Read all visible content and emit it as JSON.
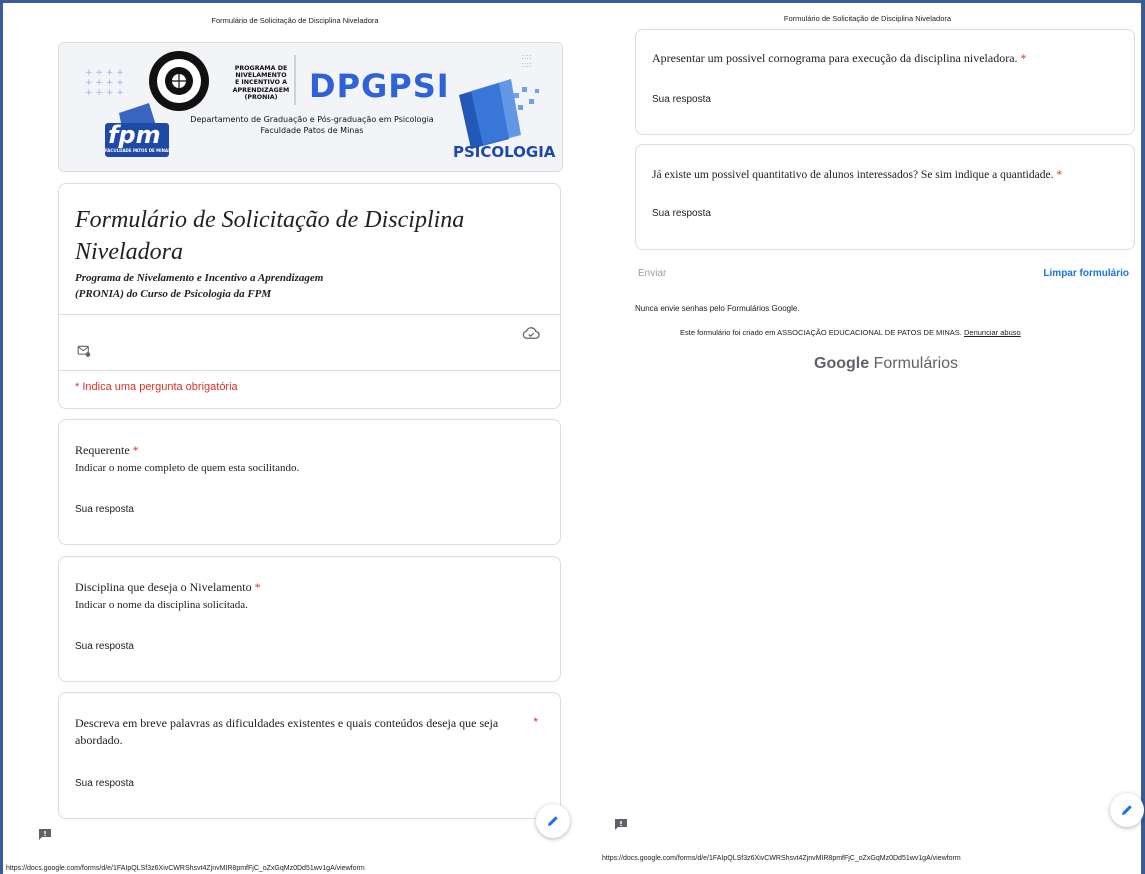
{
  "print_title": "Formulário de Solicitação de Disciplina Niveladora",
  "url": "https://docs.google.com/forms/d/e/1FAIpQLSf3z6XivCWRShsvt4ZjnvMIR8pmfFjC_oZxGqMz0Dd51wv1gA/viewform",
  "banner": {
    "program_lines": [
      "PROGRAMA DE",
      "NIVELAMENTO",
      "E INCENTIVO A",
      "APRENDIZAGEM",
      "(PRONIA)"
    ],
    "logo_text": "DPGPSI",
    "department": "Departamento de Graduação e Pós-graduação em Psicologia",
    "faculty": "Faculdade Patos de Minas",
    "fpm_text": "fpm",
    "fpm_sub": "FACULDADE PATOS DE MINAS",
    "psicologia": "PSICOLOGIA"
  },
  "form": {
    "title": "Formulário de Solicitação de Disciplina Niveladora",
    "description_line1": "Programa de Nivelamento e Incentivo a Aprendizagem",
    "description_line2": "(PRONIA) do Curso de Psicologia da FPM",
    "required_note": "* Indica uma pergunta obrigatória"
  },
  "questions": [
    {
      "title": "Requerente",
      "required": "*",
      "description": "Indicar o nome completo de quem esta socilitando.",
      "placeholder": "Sua resposta"
    },
    {
      "title": "Disciplina que deseja o Nivelamento",
      "required": "*",
      "description": "Indicar o nome da disciplina solicitada.",
      "placeholder": "Sua resposta"
    },
    {
      "title": "Descreva em breve palavras as dificuldades existentes e quais conteúdos deseja que seja",
      "title_line2": "abordado.",
      "required": "*",
      "placeholder": "Sua resposta"
    },
    {
      "title": "Apresentar um possivel cornograma para execução da disciplina niveladora.",
      "required": "*",
      "placeholder": "Sua resposta"
    },
    {
      "title": "Já existe um possivel quantitativo de alunos interessados? Se sim indique a quantidade.",
      "required": "*",
      "placeholder": "Sua resposta"
    }
  ],
  "footer": {
    "send_label": "Enviar",
    "clear_label": "Limpar formulário",
    "never_password": "Nunca envie senhas pelo Formulários Google.",
    "created_in": "Este formulário foi criado em ASSOCIAÇÃO EDUCACIONAL DE PATOS DE MINAS.",
    "report_abuse": "Denunciar abuso",
    "google": "Google",
    "forms": "Formulários"
  },
  "icons": {
    "cloud": "cloud-done-icon",
    "mail": "mail-settings-icon",
    "edit": "pencil-icon",
    "feedback": "feedback-icon"
  },
  "colors": {
    "frame": "#3a5a98",
    "required": "#d93025",
    "link": "#1a73e8",
    "dpgpsi": "#2f62d6"
  }
}
